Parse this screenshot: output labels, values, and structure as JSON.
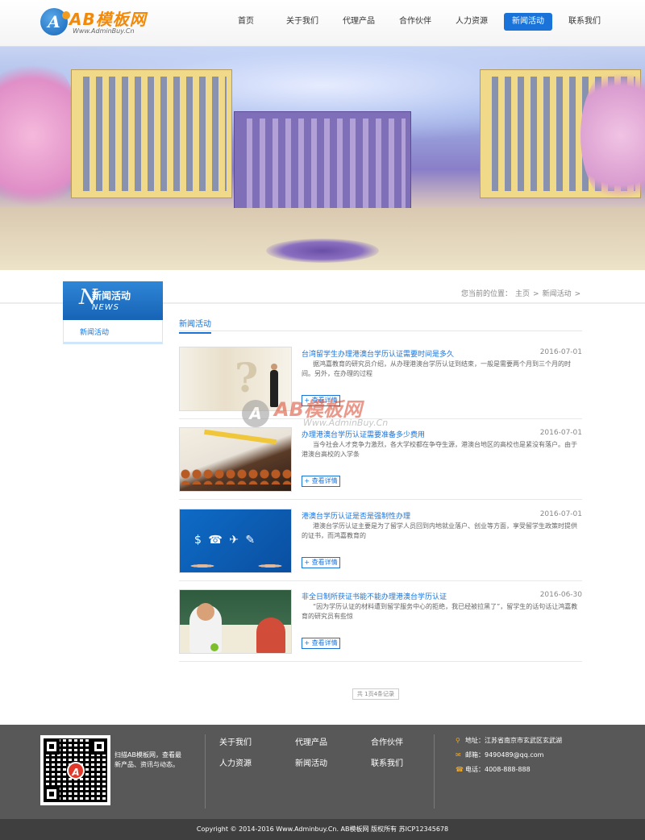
{
  "header": {
    "logo_title": "AB模板网",
    "logo_sub": "Www.AdminBuy.Cn",
    "nav": [
      "首页",
      "关于我们",
      "代理产品",
      "合作伙伴",
      "人力资源",
      "新闻活动",
      "联系我们"
    ],
    "active_nav": "新闻活动"
  },
  "sidebar": {
    "title_cn": "新闻活动",
    "title_en": "NEWS",
    "title_big": "N",
    "items": [
      "新闻活动"
    ]
  },
  "breadcrumb": {
    "prefix": "您当前的位置：",
    "items": [
      "主页",
      ">",
      "新闻活动",
      ">"
    ]
  },
  "section_title": "新闻活动",
  "news": [
    {
      "title": "台湾留学生办理港澳台学历认证需要时间是多久",
      "date": "2016-07-01",
      "desc": "据鸿嘉教育的研究员介绍，从办理港澳台学历认证到结束，一般是需要两个月到三个月的时间。另外，在办理的过程",
      "more": "+ 查看详情"
    },
    {
      "title": "办理港澳台学历认证需要准备多少费用",
      "date": "2016-07-01",
      "desc": "当今社会人才竞争力激烈，各大学校都在争夺生源，港澳台地区的高校也是紧没有落户。由于港澳台高校的入学条",
      "more": "+ 查看详情"
    },
    {
      "title": "港澳台学历认证是否是强制性办理",
      "date": "2016-07-01",
      "desc": "港澳台学历认证主要是为了留学人员回到内地就业落户、创业等方面，享受留学生政策时提供的证书，而鸿嘉教育的",
      "more": "+ 查看详情"
    },
    {
      "title": "非全日制所获证书能不能办理港澳台学历认证",
      "date": "2016-06-30",
      "desc": "“因为学历认证的材料遭到留学服务中心的拒绝，我已经被拉黑了”，留学生的话句话让鸿嘉教育的研究员有些惊",
      "more": "+ 查看详情"
    }
  ],
  "thumb_labels": {
    "icons": "$ ☎ ✈ ✎"
  },
  "pager": "共 1页4条记录",
  "watermark": {
    "title": "AB模板网",
    "sub": "Www.AdminBuy.Cn",
    "mark": "A"
  },
  "footer": {
    "qr_text": "扫描AB模板网，查看最新产品、资讯与动态。",
    "links_row1": [
      "关于我们",
      "代理产品",
      "合作伙伴"
    ],
    "links_row2": [
      "人力资源",
      "新闻活动",
      "联系我们"
    ],
    "address": "地址：江苏省南京市玄武区玄武湖",
    "email": "邮箱：9490489@qq.com",
    "phone": "电话：4008-888-888",
    "copyright": "Copyright © 2014-2016 Www.Adminbuy.Cn. AB模板网 版权所有  苏ICP12345678"
  },
  "colors": {
    "accent": "#1a73d9",
    "logo_orange": "#f18a0b",
    "footer_bg": "#585858",
    "copyright_bg": "#3f3f3f"
  }
}
